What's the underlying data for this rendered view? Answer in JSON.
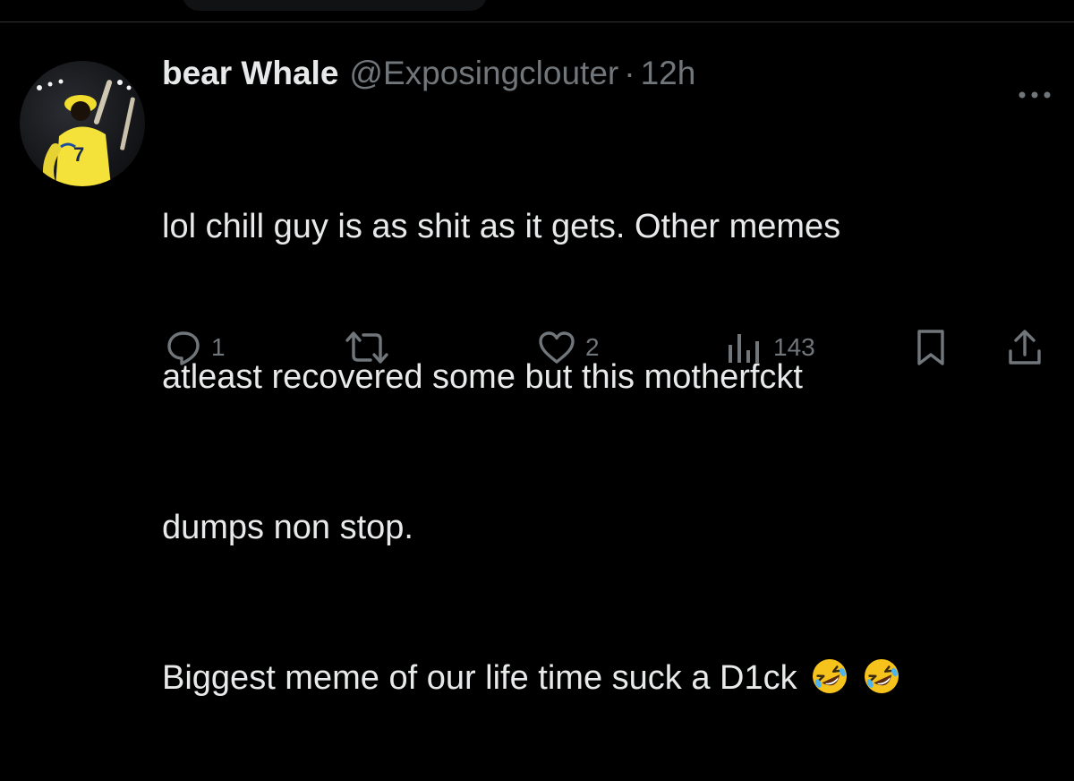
{
  "tweet": {
    "display_name": "bear Whale",
    "handle": "@Exposingclouter",
    "separator": "·",
    "time": "12h",
    "lines": [
      "lol chill guy is as shit as it gets.  Other memes",
      "atleast recovered some but this motherfckt",
      "dumps non stop.",
      "Biggest meme of our life time suck a D1ck"
    ],
    "emojis": [
      "rolling-on-floor-laughing",
      "rolling-on-floor-laughing"
    ]
  },
  "actions": {
    "reply_count": "1",
    "retweet_count": "",
    "like_count": "2",
    "views_count": "143"
  },
  "icons": {
    "reply": "reply-icon",
    "retweet": "retweet-icon",
    "like": "heart-icon",
    "views": "views-icon",
    "bookmark": "bookmark-icon",
    "share": "share-icon",
    "more": "more-icon"
  },
  "colors": {
    "background": "#000000",
    "text_primary": "#e7e9ea",
    "text_secondary": "#71767b",
    "avatar_jersey": "#f5e33b"
  }
}
